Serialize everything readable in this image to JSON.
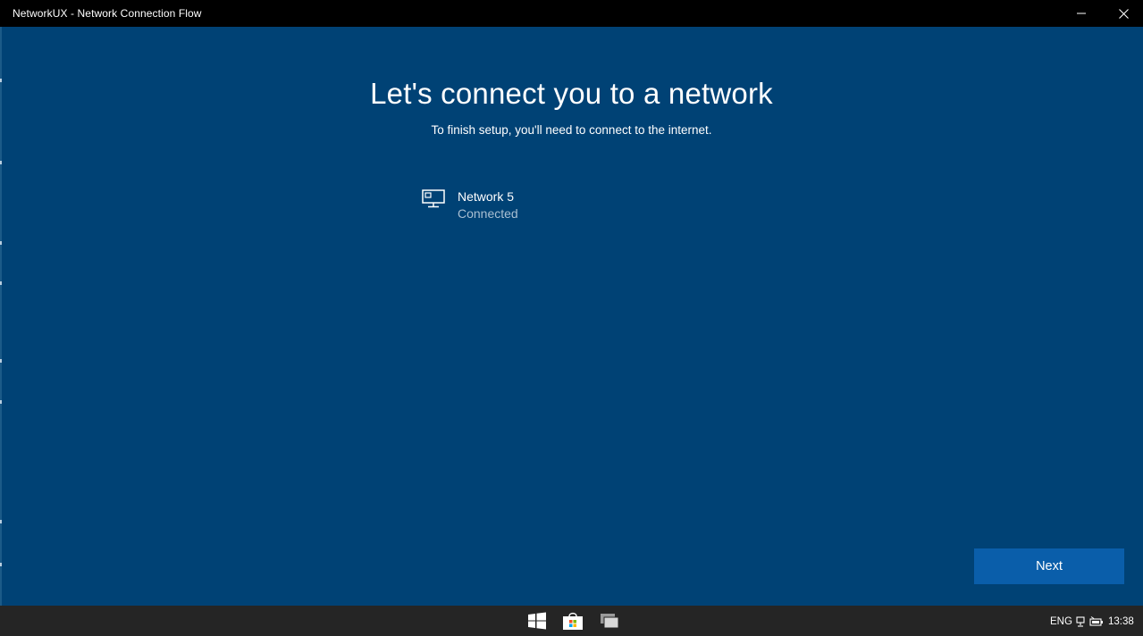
{
  "window": {
    "title": "NetworkUX - Network Connection Flow",
    "background_color": "#004275"
  },
  "page": {
    "heading": "Let's connect you to a network",
    "subheading": "To finish setup, you'll need to connect to the internet."
  },
  "networks": [
    {
      "name": "Network 5",
      "status": "Connected",
      "icon": "ethernet-network-icon"
    }
  ],
  "actions": {
    "next_label": "Next",
    "accent_color": "#0a5eaa"
  },
  "taskbar": {
    "apps": [
      "windows-start-icon",
      "store-icon",
      "task-view-icon"
    ],
    "language": "ENG",
    "clock": "13:38",
    "tray_icons": [
      "network-icon",
      "battery-icon"
    ]
  }
}
